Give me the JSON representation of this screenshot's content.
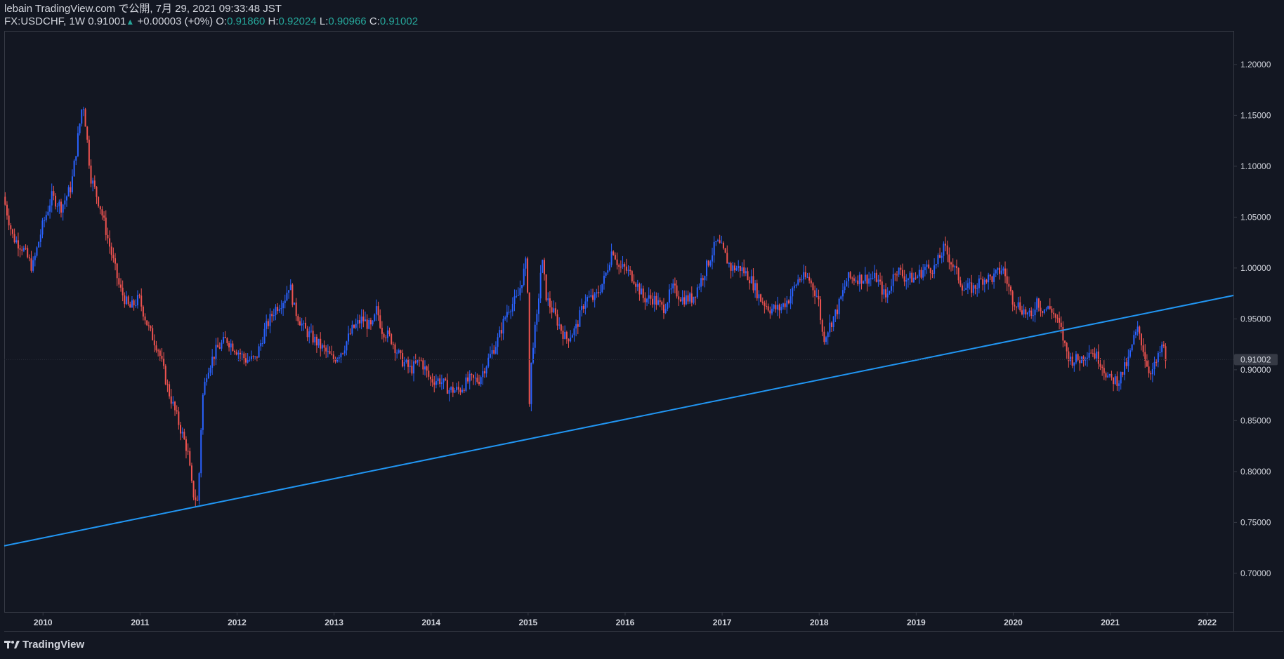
{
  "header": {
    "publish_line": "lebain TradingView.com で公開, 7月 29, 2021 09:33:48 JST",
    "symbol": "FX:USDCHF, 1W",
    "last": "0.91001",
    "change": "+0.00003 (+0%)",
    "o_label": "O:",
    "o": "0.91860",
    "h_label": "H:",
    "h": "0.92024",
    "l_label": "L:",
    "l": "0.90966",
    "c_label": "C:",
    "c": "0.91002"
  },
  "footer": {
    "brand": "TradingView"
  },
  "colors": {
    "background": "#131722",
    "bull": "#2962ff",
    "bear": "#ef5350",
    "trendline": "#2196f3",
    "text": "#d1d4dc",
    "ohlc": "#26a69a"
  },
  "chart_data": {
    "type": "candlestick",
    "symbol": "FX:USDCHF",
    "interval": "1W",
    "y_ticks": [
      0.7,
      0.75,
      0.8,
      0.85,
      0.9,
      0.95,
      1.0,
      1.05,
      1.1,
      1.15,
      1.2
    ],
    "y_tick_labels": [
      "0.70000",
      "0.75000",
      "0.80000",
      "0.85000",
      "0.90000",
      "0.95000",
      "1.00000",
      "1.05000",
      "1.10000",
      "1.15000",
      "1.20000"
    ],
    "ylim": [
      0.662,
      1.233
    ],
    "x_ticks": [
      "2010",
      "2011",
      "2012",
      "2013",
      "2014",
      "2015",
      "2016",
      "2017",
      "2018",
      "2019",
      "2020",
      "2021",
      "2022"
    ],
    "xlim": [
      2009.6,
      2022.27
    ],
    "last_price_label": "0.91002",
    "last_price": 0.91002,
    "trendline": {
      "x": [
        2009.6,
        2022.27
      ],
      "y": [
        0.727,
        0.973
      ]
    },
    "price_path": [
      [
        2009.6,
        1.07
      ],
      [
        2009.7,
        1.03
      ],
      [
        2009.8,
        1.02
      ],
      [
        2009.9,
        1.0
      ],
      [
        2010.0,
        1.04
      ],
      [
        2010.1,
        1.07
      ],
      [
        2010.2,
        1.06
      ],
      [
        2010.3,
        1.08
      ],
      [
        2010.4,
        1.15
      ],
      [
        2010.42,
        1.165
      ],
      [
        2010.45,
        1.14
      ],
      [
        2010.5,
        1.09
      ],
      [
        2010.6,
        1.06
      ],
      [
        2010.7,
        1.02
      ],
      [
        2010.8,
        0.98
      ],
      [
        2010.9,
        0.96
      ],
      [
        2011.0,
        0.97
      ],
      [
        2011.1,
        0.94
      ],
      [
        2011.2,
        0.92
      ],
      [
        2011.3,
        0.88
      ],
      [
        2011.4,
        0.85
      ],
      [
        2011.5,
        0.82
      ],
      [
        2011.55,
        0.78
      ],
      [
        2011.6,
        0.77
      ],
      [
        2011.62,
        0.8
      ],
      [
        2011.65,
        0.87
      ],
      [
        2011.7,
        0.9
      ],
      [
        2011.8,
        0.92
      ],
      [
        2011.9,
        0.93
      ],
      [
        2012.0,
        0.92
      ],
      [
        2012.1,
        0.91
      ],
      [
        2012.2,
        0.91
      ],
      [
        2012.3,
        0.94
      ],
      [
        2012.4,
        0.96
      ],
      [
        2012.5,
        0.97
      ],
      [
        2012.55,
        0.985
      ],
      [
        2012.6,
        0.96
      ],
      [
        2012.7,
        0.94
      ],
      [
        2012.8,
        0.93
      ],
      [
        2012.9,
        0.92
      ],
      [
        2013.0,
        0.91
      ],
      [
        2013.1,
        0.92
      ],
      [
        2013.2,
        0.94
      ],
      [
        2013.3,
        0.95
      ],
      [
        2013.4,
        0.94
      ],
      [
        2013.45,
        0.96
      ],
      [
        2013.5,
        0.94
      ],
      [
        2013.6,
        0.93
      ],
      [
        2013.7,
        0.91
      ],
      [
        2013.8,
        0.9
      ],
      [
        2013.9,
        0.91
      ],
      [
        2014.0,
        0.89
      ],
      [
        2014.1,
        0.89
      ],
      [
        2014.2,
        0.88
      ],
      [
        2014.3,
        0.88
      ],
      [
        2014.4,
        0.89
      ],
      [
        2014.5,
        0.89
      ],
      [
        2014.6,
        0.91
      ],
      [
        2014.7,
        0.93
      ],
      [
        2014.8,
        0.96
      ],
      [
        2014.9,
        0.97
      ],
      [
        2014.95,
        0.99
      ],
      [
        2015.0,
        1.01
      ],
      [
        2015.02,
        0.86
      ],
      [
        2015.05,
        0.92
      ],
      [
        2015.1,
        0.95
      ],
      [
        2015.15,
        1.01
      ],
      [
        2015.2,
        0.97
      ],
      [
        2015.3,
        0.95
      ],
      [
        2015.4,
        0.93
      ],
      [
        2015.5,
        0.94
      ],
      [
        2015.6,
        0.97
      ],
      [
        2015.7,
        0.97
      ],
      [
        2015.8,
        0.99
      ],
      [
        2015.88,
        1.02
      ],
      [
        2015.95,
        1.0
      ],
      [
        2016.0,
        1.0
      ],
      [
        2016.1,
        0.99
      ],
      [
        2016.2,
        0.97
      ],
      [
        2016.3,
        0.97
      ],
      [
        2016.4,
        0.96
      ],
      [
        2016.5,
        0.98
      ],
      [
        2016.6,
        0.97
      ],
      [
        2016.7,
        0.97
      ],
      [
        2016.8,
        0.99
      ],
      [
        2016.95,
        1.025
      ],
      [
        2017.0,
        1.02
      ],
      [
        2017.1,
        1.0
      ],
      [
        2017.2,
        1.0
      ],
      [
        2017.3,
        0.99
      ],
      [
        2017.4,
        0.97
      ],
      [
        2017.5,
        0.96
      ],
      [
        2017.6,
        0.96
      ],
      [
        2017.7,
        0.97
      ],
      [
        2017.8,
        0.99
      ],
      [
        2017.9,
        0.99
      ],
      [
        2018.0,
        0.97
      ],
      [
        2018.05,
        0.93
      ],
      [
        2018.1,
        0.94
      ],
      [
        2018.2,
        0.96
      ],
      [
        2018.3,
        0.99
      ],
      [
        2018.4,
        0.99
      ],
      [
        2018.5,
        0.99
      ],
      [
        2018.6,
        0.99
      ],
      [
        2018.7,
        0.97
      ],
      [
        2018.8,
        1.0
      ],
      [
        2018.9,
        0.99
      ],
      [
        2019.0,
        0.99
      ],
      [
        2019.1,
        1.0
      ],
      [
        2019.2,
        1.0
      ],
      [
        2019.3,
        1.02
      ],
      [
        2019.4,
        1.0
      ],
      [
        2019.5,
        0.98
      ],
      [
        2019.6,
        0.98
      ],
      [
        2019.7,
        0.99
      ],
      [
        2019.8,
        0.99
      ],
      [
        2019.9,
        1.0
      ],
      [
        2020.0,
        0.97
      ],
      [
        2020.1,
        0.96
      ],
      [
        2020.2,
        0.95
      ],
      [
        2020.25,
        0.97
      ],
      [
        2020.3,
        0.96
      ],
      [
        2020.4,
        0.96
      ],
      [
        2020.5,
        0.94
      ],
      [
        2020.55,
        0.92
      ],
      [
        2020.6,
        0.91
      ],
      [
        2020.7,
        0.91
      ],
      [
        2020.8,
        0.92
      ],
      [
        2020.9,
        0.91
      ],
      [
        2021.0,
        0.89
      ],
      [
        2021.1,
        0.89
      ],
      [
        2021.2,
        0.91
      ],
      [
        2021.25,
        0.93
      ],
      [
        2021.3,
        0.94
      ],
      [
        2021.35,
        0.92
      ],
      [
        2021.4,
        0.9
      ],
      [
        2021.45,
        0.9
      ],
      [
        2021.5,
        0.91
      ],
      [
        2021.55,
        0.925
      ],
      [
        2021.58,
        0.91
      ]
    ]
  }
}
